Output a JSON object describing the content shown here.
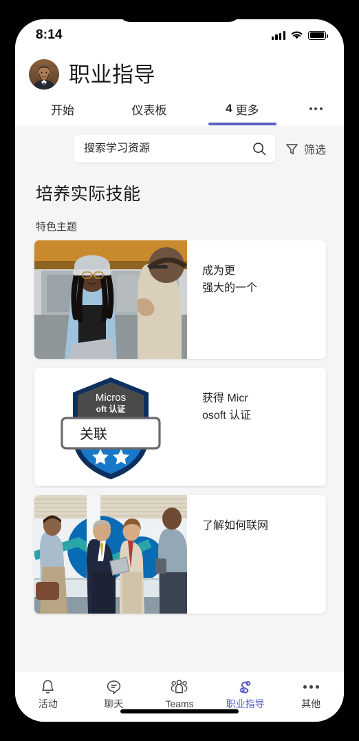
{
  "theme": {
    "accent": "#5b5fc7",
    "content_bg": "#f5f5f5",
    "card_bg": "#ffffff"
  },
  "status_bar": {
    "time": "8:14",
    "signal_icon": "cellular-signal-icon",
    "wifi_icon": "wifi-icon",
    "battery_icon": "battery-icon"
  },
  "header": {
    "avatar_name": "user-avatar",
    "title": "职业指导"
  },
  "tabs": [
    {
      "label": "开始",
      "active": false,
      "badge": ""
    },
    {
      "label": "仪表板",
      "active": false,
      "badge": ""
    },
    {
      "label": "更多",
      "active": true,
      "badge": "4"
    }
  ],
  "tabs_overflow_label": "more-tabs-overflow",
  "search": {
    "placeholder": "搜索学习资源",
    "value": "",
    "search_icon": "search-icon",
    "filter_label": "筛选",
    "filter_icon": "filter-funnel-icon"
  },
  "main": {
    "section_title": "培养实际技能",
    "section_subtitle": "特色主题",
    "cards": [
      {
        "title": "成为更\n强大的一个",
        "title_line1": "成为更",
        "title_line2": "强大的一个",
        "image_name": "card-image-woman-conversation"
      },
      {
        "title": "获得 Micr\nosoft 认证",
        "title_line1": "获得 Micr",
        "title_line2": "osoft 认证",
        "image_name": "card-image-microsoft-certified-badge",
        "badge": {
          "top_line1": "Micros",
          "top_line2": "oft 认证",
          "ribbon_text": "关联",
          "stars": 2
        }
      },
      {
        "title": "了解如何联网",
        "title_line1": "了解如何联网",
        "title_line2": "",
        "image_name": "card-image-business-networking"
      }
    ]
  },
  "bottom_nav": [
    {
      "label": "活动",
      "icon": "bell-icon",
      "active": false
    },
    {
      "label": "聊天",
      "icon": "chat-bubble-icon",
      "active": false
    },
    {
      "label": "Teams",
      "icon": "people-team-icon",
      "active": false
    },
    {
      "label": "职业指导",
      "icon": "career-coach-loop-icon",
      "active": true
    },
    {
      "label": "其他",
      "icon": "ellipsis-icon",
      "active": false
    }
  ]
}
